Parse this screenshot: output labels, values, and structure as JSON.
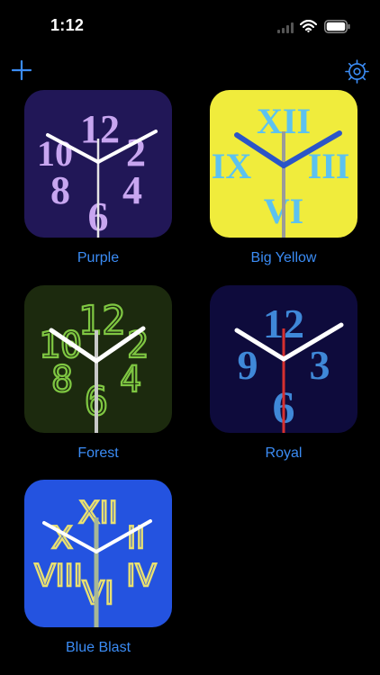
{
  "status_bar": {
    "time": "1:12"
  },
  "toolbar": {
    "add_icon": "plus-icon",
    "settings_icon": "gear-icon"
  },
  "colors": {
    "accent": "#3b8cf5",
    "background": "#000000"
  },
  "clocks": [
    {
      "label": "Purple",
      "background": "#211757",
      "numeral_color": "#c8a6f0",
      "numerals": [
        "12",
        "10",
        "2",
        "8",
        "4",
        "6"
      ]
    },
    {
      "label": "Big Yellow",
      "background": "#f0ec3c",
      "numeral_color": "#5cc2f0",
      "numerals": [
        "XII",
        "IX",
        "III",
        "VI"
      ]
    },
    {
      "label": "Forest",
      "background": "#1c2a0e",
      "numeral_color": "#7fc742",
      "numerals": [
        "12",
        "10",
        "2",
        "8",
        "4",
        "6"
      ]
    },
    {
      "label": "Royal",
      "background": "#0e0b3c",
      "numeral_color": "#3f88d8",
      "numerals": [
        "12",
        "9",
        "3",
        "6"
      ]
    },
    {
      "label": "Blue Blast",
      "background": "#2453e0",
      "numeral_color": "#e9e070",
      "numerals": [
        "XII",
        "X",
        "II",
        "VIII",
        "IV",
        "VI"
      ]
    }
  ]
}
